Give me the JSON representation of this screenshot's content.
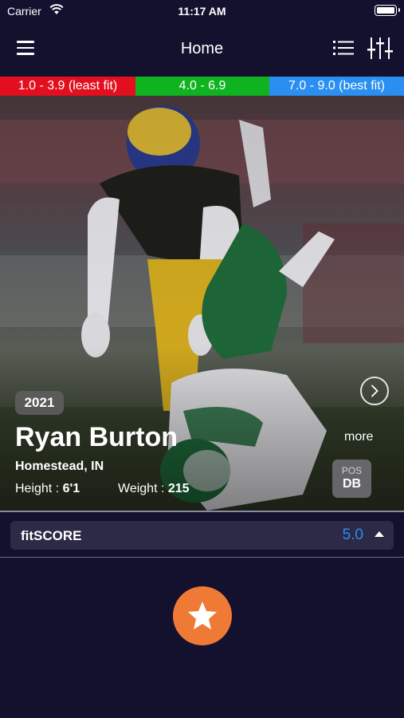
{
  "status_bar": {
    "carrier": "Carrier",
    "time": "11:17 AM"
  },
  "nav": {
    "title": "Home",
    "menu_icon": "hamburger-menu-icon",
    "list_icon": "list-icon",
    "filter_icon": "filter-sliders-icon"
  },
  "fit_scale": [
    {
      "label": "1.0 - 3.9 (least fit)",
      "color": "#e30f1e"
    },
    {
      "label": "4.0 - 6.9",
      "color": "#0fb31f"
    },
    {
      "label": "7.0 - 9.0 (best fit)",
      "color": "#2a8ff0"
    }
  ],
  "player": {
    "year": "2021",
    "name": "Ryan Burton",
    "location": "Homestead, IN",
    "height_label": "Height : ",
    "height": "6'1",
    "weight_label": "Weight : ",
    "weight": "215",
    "pos_label": "POS",
    "pos": "DB",
    "more": "more"
  },
  "fitscore": {
    "label": "fitSCORE",
    "value": "5.0"
  },
  "icons": {
    "next": "chevron-right-circle-icon",
    "favorite": "star-icon"
  },
  "colors": {
    "background": "#14112e",
    "accent": "#2a8ff0",
    "favorite": "#ee7a36"
  }
}
